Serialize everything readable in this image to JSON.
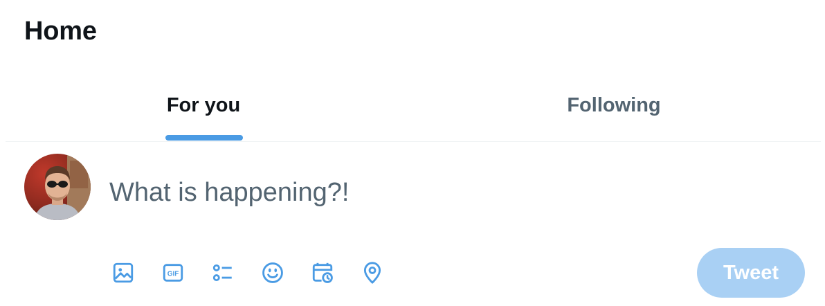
{
  "header": {
    "title": "Home"
  },
  "tabs": [
    {
      "label": "For you",
      "active": true
    },
    {
      "label": "Following",
      "active": false
    }
  ],
  "composer": {
    "placeholder": "What is happening?!",
    "value": "",
    "tools": [
      {
        "icon": "image-icon"
      },
      {
        "icon": "gif-icon",
        "label": "GIF"
      },
      {
        "icon": "poll-icon"
      },
      {
        "icon": "emoji-icon"
      },
      {
        "icon": "schedule-icon"
      },
      {
        "icon": "location-icon"
      }
    ],
    "submit_label": "Tweet",
    "submit_disabled": true
  },
  "colors": {
    "accent": "#1d9bf0",
    "indicator": "#4a9be4",
    "icon": "#4a9be4",
    "button_disabled": "#a9d0f4",
    "text_primary": "#0f1419",
    "text_secondary": "#536471"
  }
}
